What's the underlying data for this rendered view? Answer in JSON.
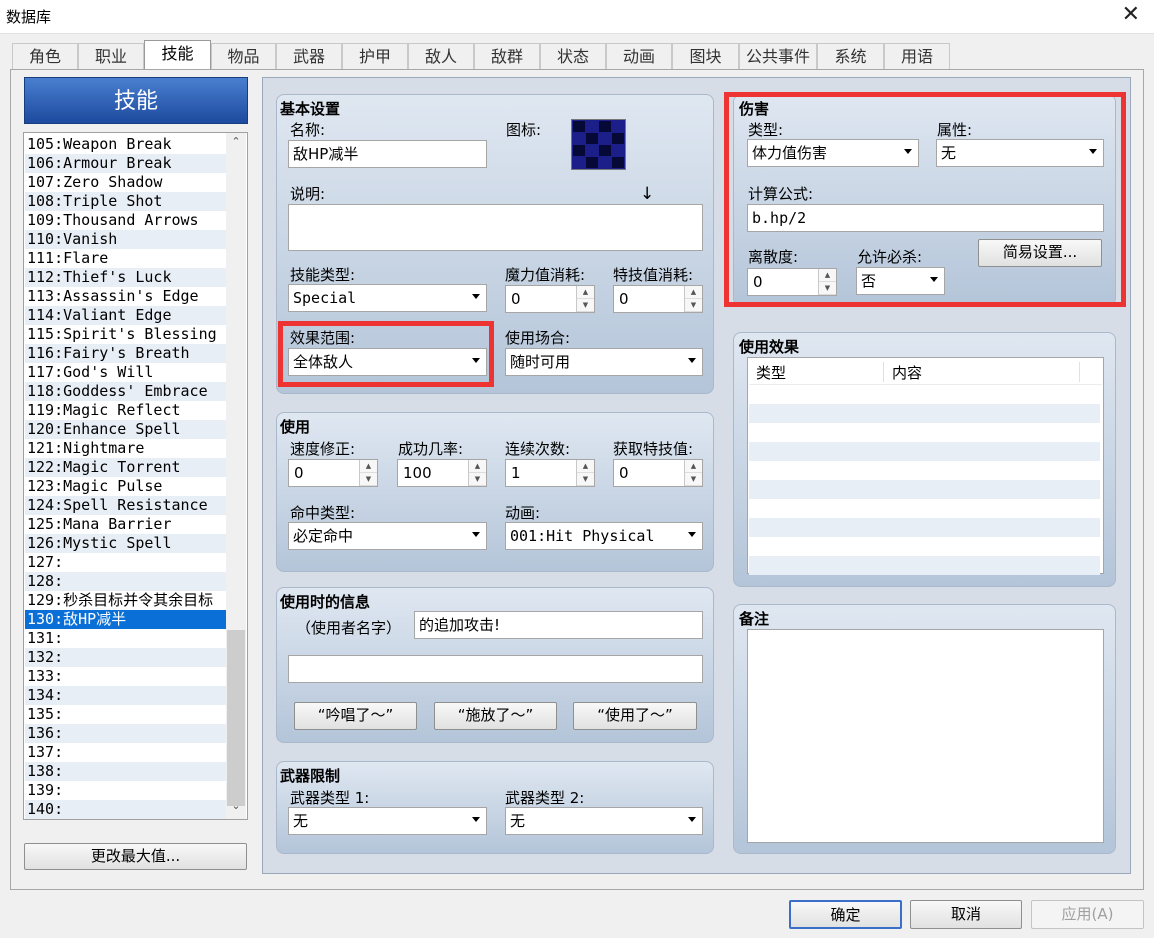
{
  "window": {
    "title": "数据库",
    "close": "✕"
  },
  "tabs": [
    "角色",
    "职业",
    "技能",
    "物品",
    "武器",
    "护甲",
    "敌人",
    "敌群",
    "状态",
    "动画",
    "图块",
    "公共事件",
    "系统",
    "用语"
  ],
  "selected_tab": "技能",
  "skills_panel": {
    "header": "技能",
    "items": [
      "105:Weapon Break",
      "106:Armour Break",
      "107:Zero Shadow",
      "108:Triple Shot",
      "109:Thousand Arrows",
      "110:Vanish",
      "111:Flare",
      "112:Thief's Luck",
      "113:Assassin's Edge",
      "114:Valiant Edge",
      "115:Spirit's Blessing",
      "116:Fairy's Breath",
      "117:God's Will",
      "118:Goddess' Embrace",
      "119:Magic Reflect",
      "120:Enhance Spell",
      "121:Nightmare",
      "122:Magic Torrent",
      "123:Magic Pulse",
      "124:Spell Resistance",
      "125:Mana Barrier",
      "126:Mystic Spell",
      "127:",
      "128:",
      "129:秒杀目标并令其余目标",
      "130:敌HP减半",
      "131:",
      "132:",
      "133:",
      "134:",
      "135:",
      "136:",
      "137:",
      "138:",
      "139:",
      "140:"
    ],
    "selected_item": "130:敌HP减半",
    "change_max_button": "更改最大值..."
  },
  "basic": {
    "title": "基本设置",
    "name_label": "名称:",
    "name_value": "敌HP减半",
    "icon_label": "图标:",
    "desc_label": "说明:",
    "desc_value": "↓",
    "skill_type_label": "技能类型:",
    "skill_type_value": "Special",
    "mp_cost_label": "魔力值消耗:",
    "mp_cost_value": "0",
    "tp_cost_label": "特技值消耗:",
    "tp_cost_value": "0",
    "scope_label": "效果范围:",
    "scope_value": "全体敌人",
    "occasion_label": "使用场合:",
    "occasion_value": "随时可用"
  },
  "invocation": {
    "title": "使用",
    "speed_label": "速度修正:",
    "speed_value": "0",
    "success_label": "成功几率:",
    "success_value": "100",
    "repeats_label": "连续次数:",
    "repeats_value": "1",
    "tp_gain_label": "获取特技值:",
    "tp_gain_value": "0",
    "hit_type_label": "命中类型:",
    "hit_type_value": "必定命中",
    "animation_label": "动画:",
    "animation_value": "001:Hit Physical"
  },
  "message": {
    "title": "使用时的信息",
    "user_name_label": "（使用者名字）",
    "line1_value": "的追加攻击!",
    "line2_value": "",
    "buttons": [
      "“吟唱了～”",
      "“施放了～”",
      "“使用了～”"
    ]
  },
  "weapon_req": {
    "title": "武器限制",
    "type1_label": "武器类型 1:",
    "type1_value": "无",
    "type2_label": "武器类型 2:",
    "type2_value": "无"
  },
  "damage": {
    "title": "伤害",
    "type_label": "类型:",
    "type_value": "体力值伤害",
    "element_label": "属性:",
    "element_value": "无",
    "formula_label": "计算公式:",
    "formula_value": "b.hp/2",
    "variance_label": "离散度:",
    "variance_value": "0",
    "critical_label": "允许必杀:",
    "critical_value": "否",
    "simple_button": "简易设置..."
  },
  "effects": {
    "title": "使用效果",
    "col_type": "类型",
    "col_content": "内容"
  },
  "note": {
    "title": "备注",
    "value": ""
  },
  "footer": {
    "ok": "确定",
    "cancel": "取消",
    "apply": "应用(A)"
  },
  "colors": {
    "highlight": "#ee3333",
    "selection": "#0a6fd6",
    "header": "#1d4a9e"
  }
}
